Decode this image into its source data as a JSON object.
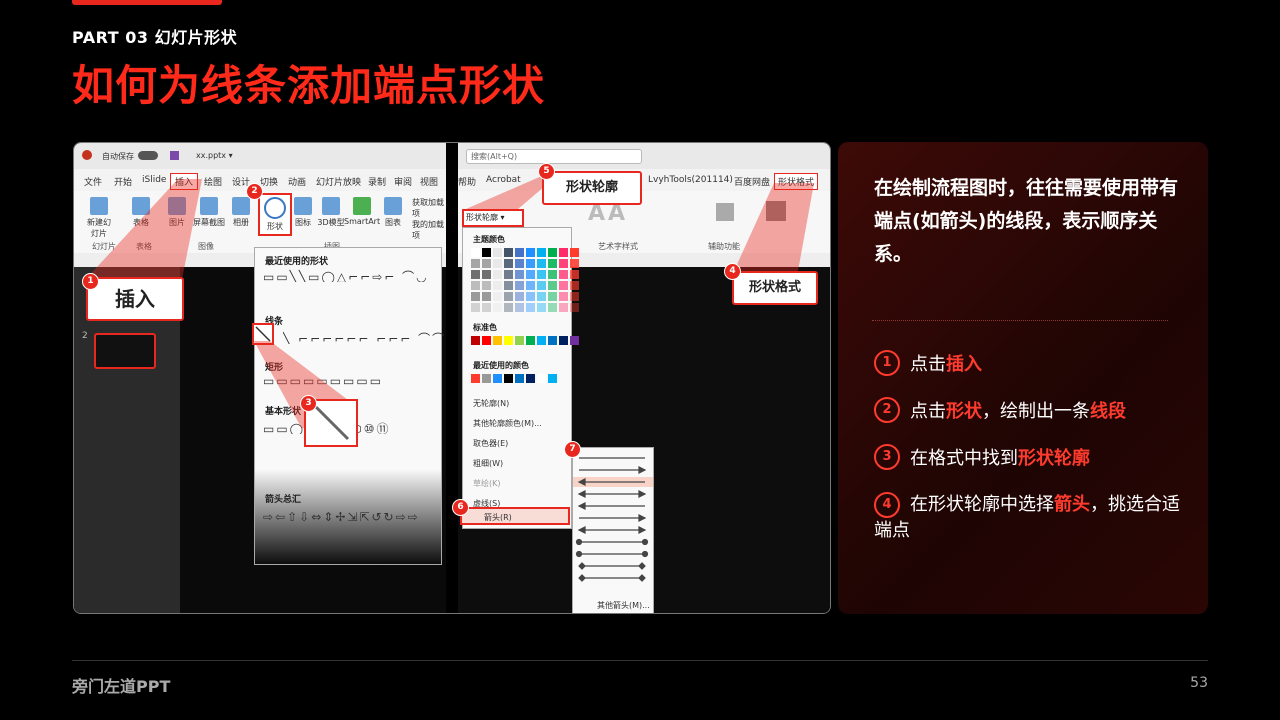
{
  "header": {
    "part": "PART 03  幻灯片形状",
    "title": "如何为线条添加端点形状"
  },
  "left_ui": {
    "autosave": "自动保存",
    "filename": "xx.pptx ▾",
    "menu": [
      "文件",
      "开始",
      "iSlide",
      "插入",
      "绘图",
      "设计",
      "切换",
      "动画",
      "幻灯片放映",
      "录制",
      "审阅",
      "视图"
    ],
    "ribbon": [
      "新建幻灯片",
      "表格",
      "图片",
      "屏幕截图",
      "相册",
      "形状",
      "图标",
      "3D模型",
      "SmartArt",
      "图表",
      "获取加载项",
      "我的加载项"
    ],
    "groups": [
      "幻灯片",
      "表格",
      "图像",
      "插图"
    ],
    "shapes_menu": {
      "recent": "最近使用的形状",
      "lines": "线条",
      "rect": "矩形",
      "basic": "基本形状",
      "arrows": "箭头总汇",
      "recent_glyphs": "▭▭╲╲▭◯△⌐⌐⇨⌐ ⌒◡",
      "line_glyphs": "╲ ⌐⌐⌐⌐⌐⌐ ⌐⌐⌐ ⌒⌒",
      "rect_glyphs": "▭▭▭▭▭▭▭▭▭",
      "basic_glyphs": "▭▭◯△◇◇⬠⬡⑩⑪",
      "arrow_glyphs": "⇨⇦⇧⇩⇔⇕✢⇲⇱↺↻⇨⇨"
    },
    "callout_insert": "插入",
    "slide_num": "2"
  },
  "right_ui": {
    "search": "搜索(Alt+Q)",
    "menu": [
      "帮助",
      "Acrobat",
      "LvyhTools(201114)",
      "百度网盘",
      "形状格式"
    ],
    "ribbon_labels": [
      "艺术字样式",
      "辅助功能"
    ],
    "outline_btn": "形状轮廓 ▾",
    "outline_menu": {
      "theme": "主题颜色",
      "standard": "标准色",
      "recent": "最近使用的颜色",
      "no_outline": "无轮廓(N)",
      "more": "其他轮廓颜色(M)...",
      "picker": "取色器(E)",
      "weight": "粗细(W)",
      "sketch": "草绘(K)",
      "dash": "虚线(S)",
      "arrow": "箭头(R)"
    },
    "arrow_more": "其他箭头(M)...",
    "callout_outline": "形状轮廓",
    "callout_format": "形状格式"
  },
  "badges": [
    "1",
    "2",
    "3",
    "4",
    "5",
    "6",
    "7"
  ],
  "side": {
    "intro": "在绘制流程图时，往往需要使用带有端点(如箭头)的线段，表示顺序关系。",
    "steps": [
      {
        "n": "1",
        "pre": "点击",
        "hl": "插入",
        "mid": "",
        "hl2": "",
        "post": ""
      },
      {
        "n": "2",
        "pre": "点击",
        "hl": "形状",
        "mid": "，绘制出一条",
        "hl2": "线段",
        "post": ""
      },
      {
        "n": "3",
        "pre": "在格式中找到",
        "hl": "形状轮廓",
        "mid": "",
        "hl2": "",
        "post": ""
      },
      {
        "n": "4",
        "pre": "在形状轮廓中选择",
        "hl": "箭头",
        "mid": "，挑选合适端点",
        "hl2": "",
        "post": ""
      }
    ]
  },
  "footer": {
    "brand": "旁门左道PPT",
    "page": "53"
  },
  "colors": {
    "accent": "#e8281e",
    "panel": "#2a0604"
  }
}
